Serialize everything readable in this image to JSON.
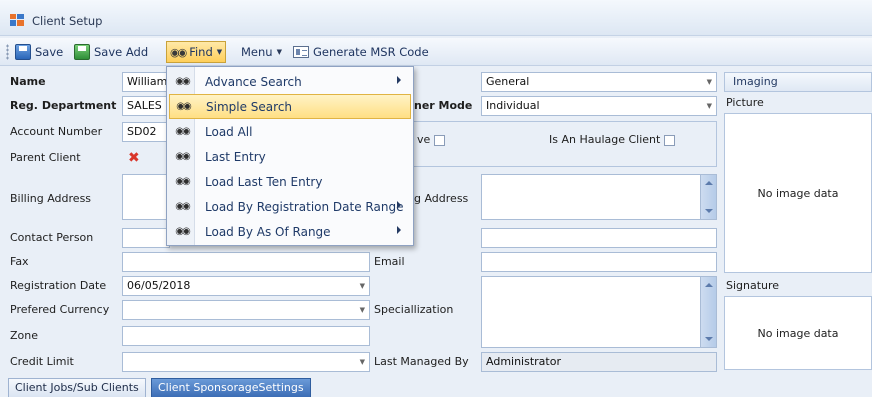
{
  "window": {
    "title": "Client Setup"
  },
  "toolbar": {
    "save_label": "Save",
    "save_add_label": "Save Add",
    "find_label": "Find",
    "menu_label": "Menu",
    "msr_label": "Generate MSR Code"
  },
  "find_menu": {
    "items": [
      {
        "label": "Advance Search",
        "icon": "binoculars-icon",
        "has_submenu": true
      },
      {
        "label": "Simple Search",
        "icon": "binoculars-icon",
        "has_submenu": false,
        "highlighted": true
      },
      {
        "label": "Load All",
        "icon": "binoculars-icon",
        "has_submenu": false
      },
      {
        "label": "Last Entry",
        "icon": "binoculars-icon",
        "has_submenu": false
      },
      {
        "label": "Load Last Ten Entry",
        "icon": "binoculars-icon",
        "has_submenu": false
      },
      {
        "label": "Load By Registration Date Range",
        "icon": "binoculars-icon",
        "has_submenu": true
      },
      {
        "label": "Load By As Of Range",
        "icon": "binoculars-icon",
        "has_submenu": true
      }
    ]
  },
  "form": {
    "name": {
      "label": "Name",
      "value": "Williams"
    },
    "reg_department": {
      "label": "Reg. Department",
      "value": "SALES D"
    },
    "account_number": {
      "label": "Account Number",
      "value": "SD02"
    },
    "parent_client": {
      "label": "Parent Client"
    },
    "billing_address": {
      "label": "Billing Address",
      "value": ""
    },
    "contact_person": {
      "label": "Contact Person",
      "value": ""
    },
    "fax": {
      "label": "Fax",
      "value": ""
    },
    "registration_date": {
      "label": "Registration Date",
      "value": "06/05/2018"
    },
    "preferred_currency": {
      "label": "Prefered Currency",
      "value": ""
    },
    "zone": {
      "label": "Zone",
      "value": ""
    },
    "credit_limit": {
      "label": "Credit Limit",
      "value": ""
    },
    "category_select": {
      "value": "General"
    },
    "owner_mode": {
      "label_fragment": "ner Mode",
      "value": "Individual"
    },
    "active_fragment": "ve",
    "haulage": {
      "label": "Is An Haulage Client"
    },
    "shipping_address": {
      "label_fragment": "g Address",
      "value": ""
    },
    "email": {
      "label": "Email",
      "value": ""
    },
    "specialization": {
      "label": "Speciallization",
      "value": ""
    },
    "last_managed_by": {
      "label": "Last Managed By",
      "value": "Administrator"
    }
  },
  "imaging": {
    "header": "Imaging",
    "picture_label": "Picture",
    "picture_placeholder": "No image data",
    "signature_label": "Signature",
    "signature_placeholder": "No image data"
  },
  "tabs": [
    {
      "label": "Client Jobs/Sub Clients",
      "selected": false
    },
    {
      "label": "Client SponsorageSettings",
      "selected": true
    }
  ]
}
